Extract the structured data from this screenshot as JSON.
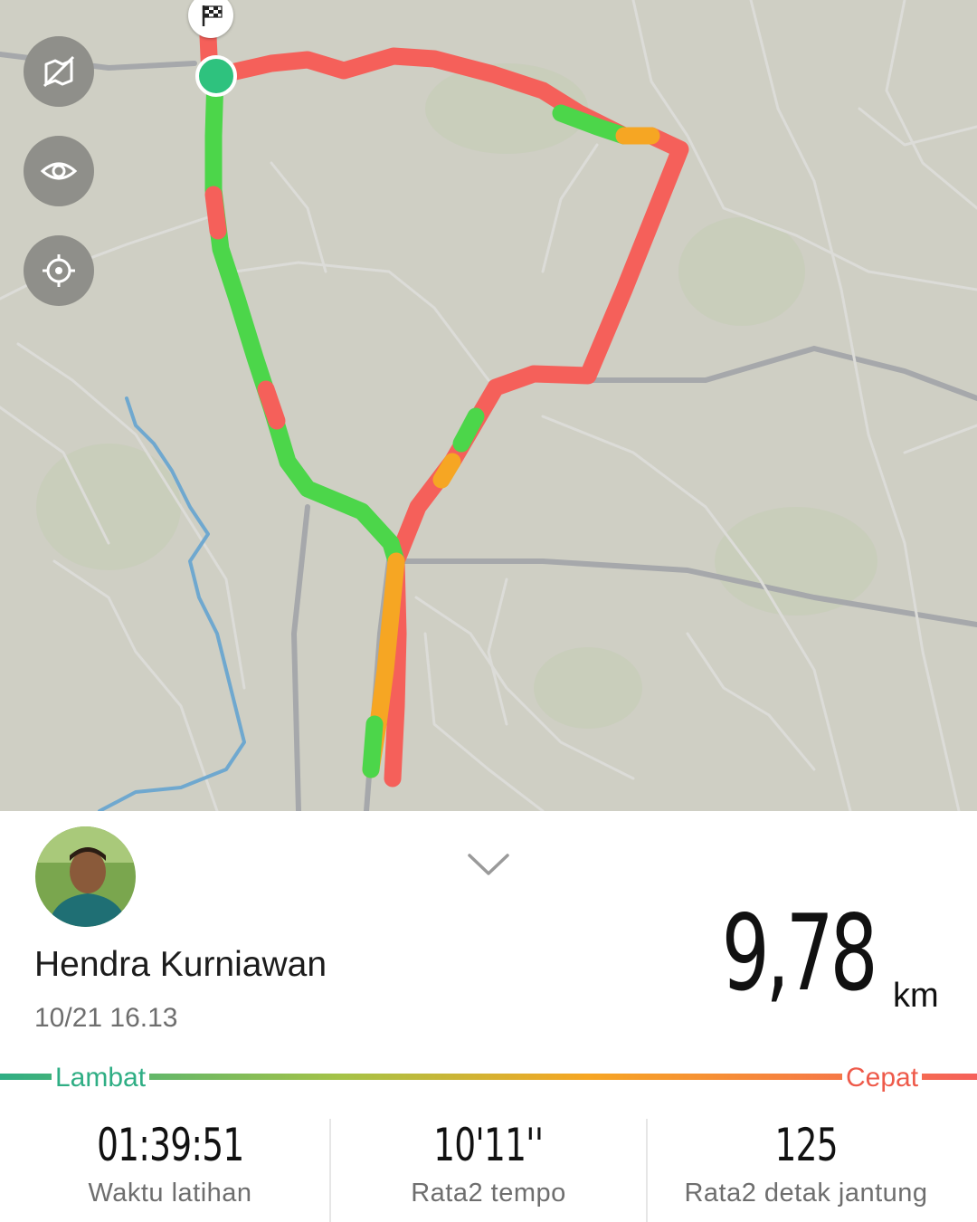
{
  "map": {
    "start_icon": "checkered-flag-icon",
    "end_marker_color": "#2ec27e",
    "buttons": [
      {
        "name": "hide-map-icon"
      },
      {
        "name": "eye-icon"
      },
      {
        "name": "locate-icon"
      }
    ],
    "pace_colors": {
      "slow": "#4cd64a",
      "medium": "#f6a623",
      "fast": "#f5605a"
    }
  },
  "activity": {
    "user_name": "Hendra Kurniawan",
    "datetime": "10/21 16.13",
    "distance": "9,78",
    "distance_unit": "km"
  },
  "speed_legend": {
    "slow_label": "Lambat",
    "fast_label": "Cepat"
  },
  "stats": [
    {
      "value": "01:39:51",
      "label": "Waktu latihan"
    },
    {
      "value": "10'11''",
      "label": "Rata2 tempo"
    },
    {
      "value": "125",
      "label": "Rata2 detak jantung"
    }
  ]
}
